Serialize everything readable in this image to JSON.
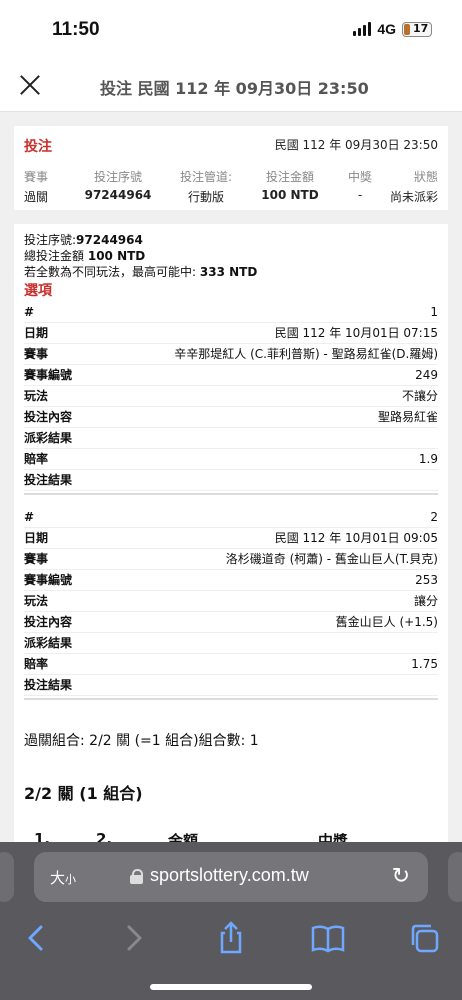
{
  "status_bar": {
    "time": "11:50",
    "network": "4G",
    "battery": "17"
  },
  "nav": {
    "title": "投注 民國 112 年 09月30日 23:50"
  },
  "summary_card": {
    "title": "投注",
    "date": "民國 112 年 09月30日 23:50",
    "headers": [
      "賽事",
      "投注序號",
      "投注管道:",
      "投注金額",
      "中獎",
      "狀態"
    ],
    "values": [
      "過關",
      "97244964",
      "行動版",
      "100 NTD",
      "-",
      "尚未派彩"
    ]
  },
  "detail": {
    "serial_label": "投注序號:",
    "serial_value": "97244964",
    "total_label": "總投注金額",
    "total_value": "100 NTD",
    "max_win_label": "若全數為不同玩法，最高可能中:",
    "max_win_value": "333 NTD",
    "options_label": "選項",
    "selections": [
      {
        "rows": [
          {
            "k": "#",
            "v": "1"
          },
          {
            "k": "日期",
            "v": "民國 112 年 10月01日 07:15"
          },
          {
            "k": "賽事",
            "v": "辛辛那堤紅人 (C.菲利普斯) - 聖路易紅雀(D.羅姆)"
          },
          {
            "k": "賽事編號",
            "v": "249"
          },
          {
            "k": "玩法",
            "v": "不讓分"
          },
          {
            "k": "投注內容",
            "v": "聖路易紅雀"
          },
          {
            "k": "派彩結果",
            "v": ""
          },
          {
            "k": "賠率",
            "v": "1.9"
          },
          {
            "k": "投注結果",
            "v": ""
          }
        ]
      },
      {
        "rows": [
          {
            "k": "#",
            "v": "2"
          },
          {
            "k": "日期",
            "v": "民國 112 年 10月01日 09:05"
          },
          {
            "k": "賽事",
            "v": "洛杉磯道奇 (柯蕭) - 舊金山巨人(T.貝克)"
          },
          {
            "k": "賽事編號",
            "v": "253"
          },
          {
            "k": "玩法",
            "v": "讓分"
          },
          {
            "k": "投注內容",
            "v": "舊金山巨人 (+1.5)"
          },
          {
            "k": "派彩結果",
            "v": ""
          },
          {
            "k": "賠率",
            "v": "1.75"
          },
          {
            "k": "投注結果",
            "v": ""
          }
        ]
      }
    ],
    "combo_text": "過關組合: 2/2 關 (=1 組合)組合數: 1",
    "combo_title": "2/2 關 (1 組合)",
    "combo_headers": [
      "1.",
      "2.",
      "金額",
      "中獎"
    ]
  },
  "browser": {
    "text_size_label": "大",
    "text_size_small": "小",
    "url": "sportslottery.com.tw",
    "icons": [
      "back-icon",
      "forward-icon",
      "share-icon",
      "bookmarks-icon",
      "tabs-icon",
      "reload-icon"
    ]
  }
}
